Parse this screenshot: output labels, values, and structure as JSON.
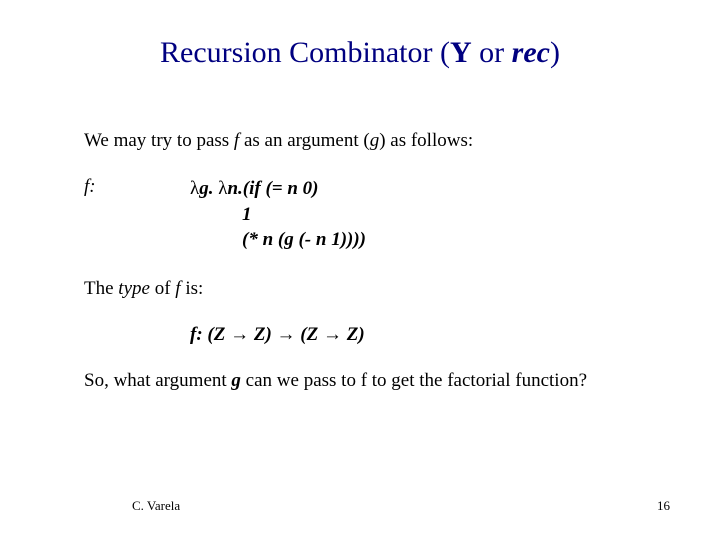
{
  "title": {
    "pre": "Recursion Combinator (",
    "Y": "Y",
    "or": " or ",
    "rec": "rec",
    "post": ")"
  },
  "intro": {
    "pre": "We may try to pass ",
    "f": "f",
    "mid": " as an argument (",
    "g": "g",
    "post": ") as follows:"
  },
  "def": {
    "label": "f:",
    "lambda1": "λ",
    "g": "g.",
    "lambda2": " λ",
    "n": "n.",
    "if": "(if (= n 0)",
    "one": "1",
    "mult": "(* n (g (- n 1))))"
  },
  "type_intro": {
    "pre": "The ",
    "type": "type",
    "mid": " of ",
    "f": "f",
    "post": " is:"
  },
  "type_expr": {
    "f": "f: ",
    "lp1": "(Z ",
    "arr1": "→",
    "z1": " Z) ",
    "arr2": "→",
    "lp2": " (Z ",
    "arr3": "→",
    "z2": " Z)"
  },
  "question": {
    "pre": "So, what argument ",
    "g": "g",
    "post": " can we pass to f to get the factorial function?"
  },
  "footer": {
    "author": "C. Varela",
    "page": "16"
  }
}
